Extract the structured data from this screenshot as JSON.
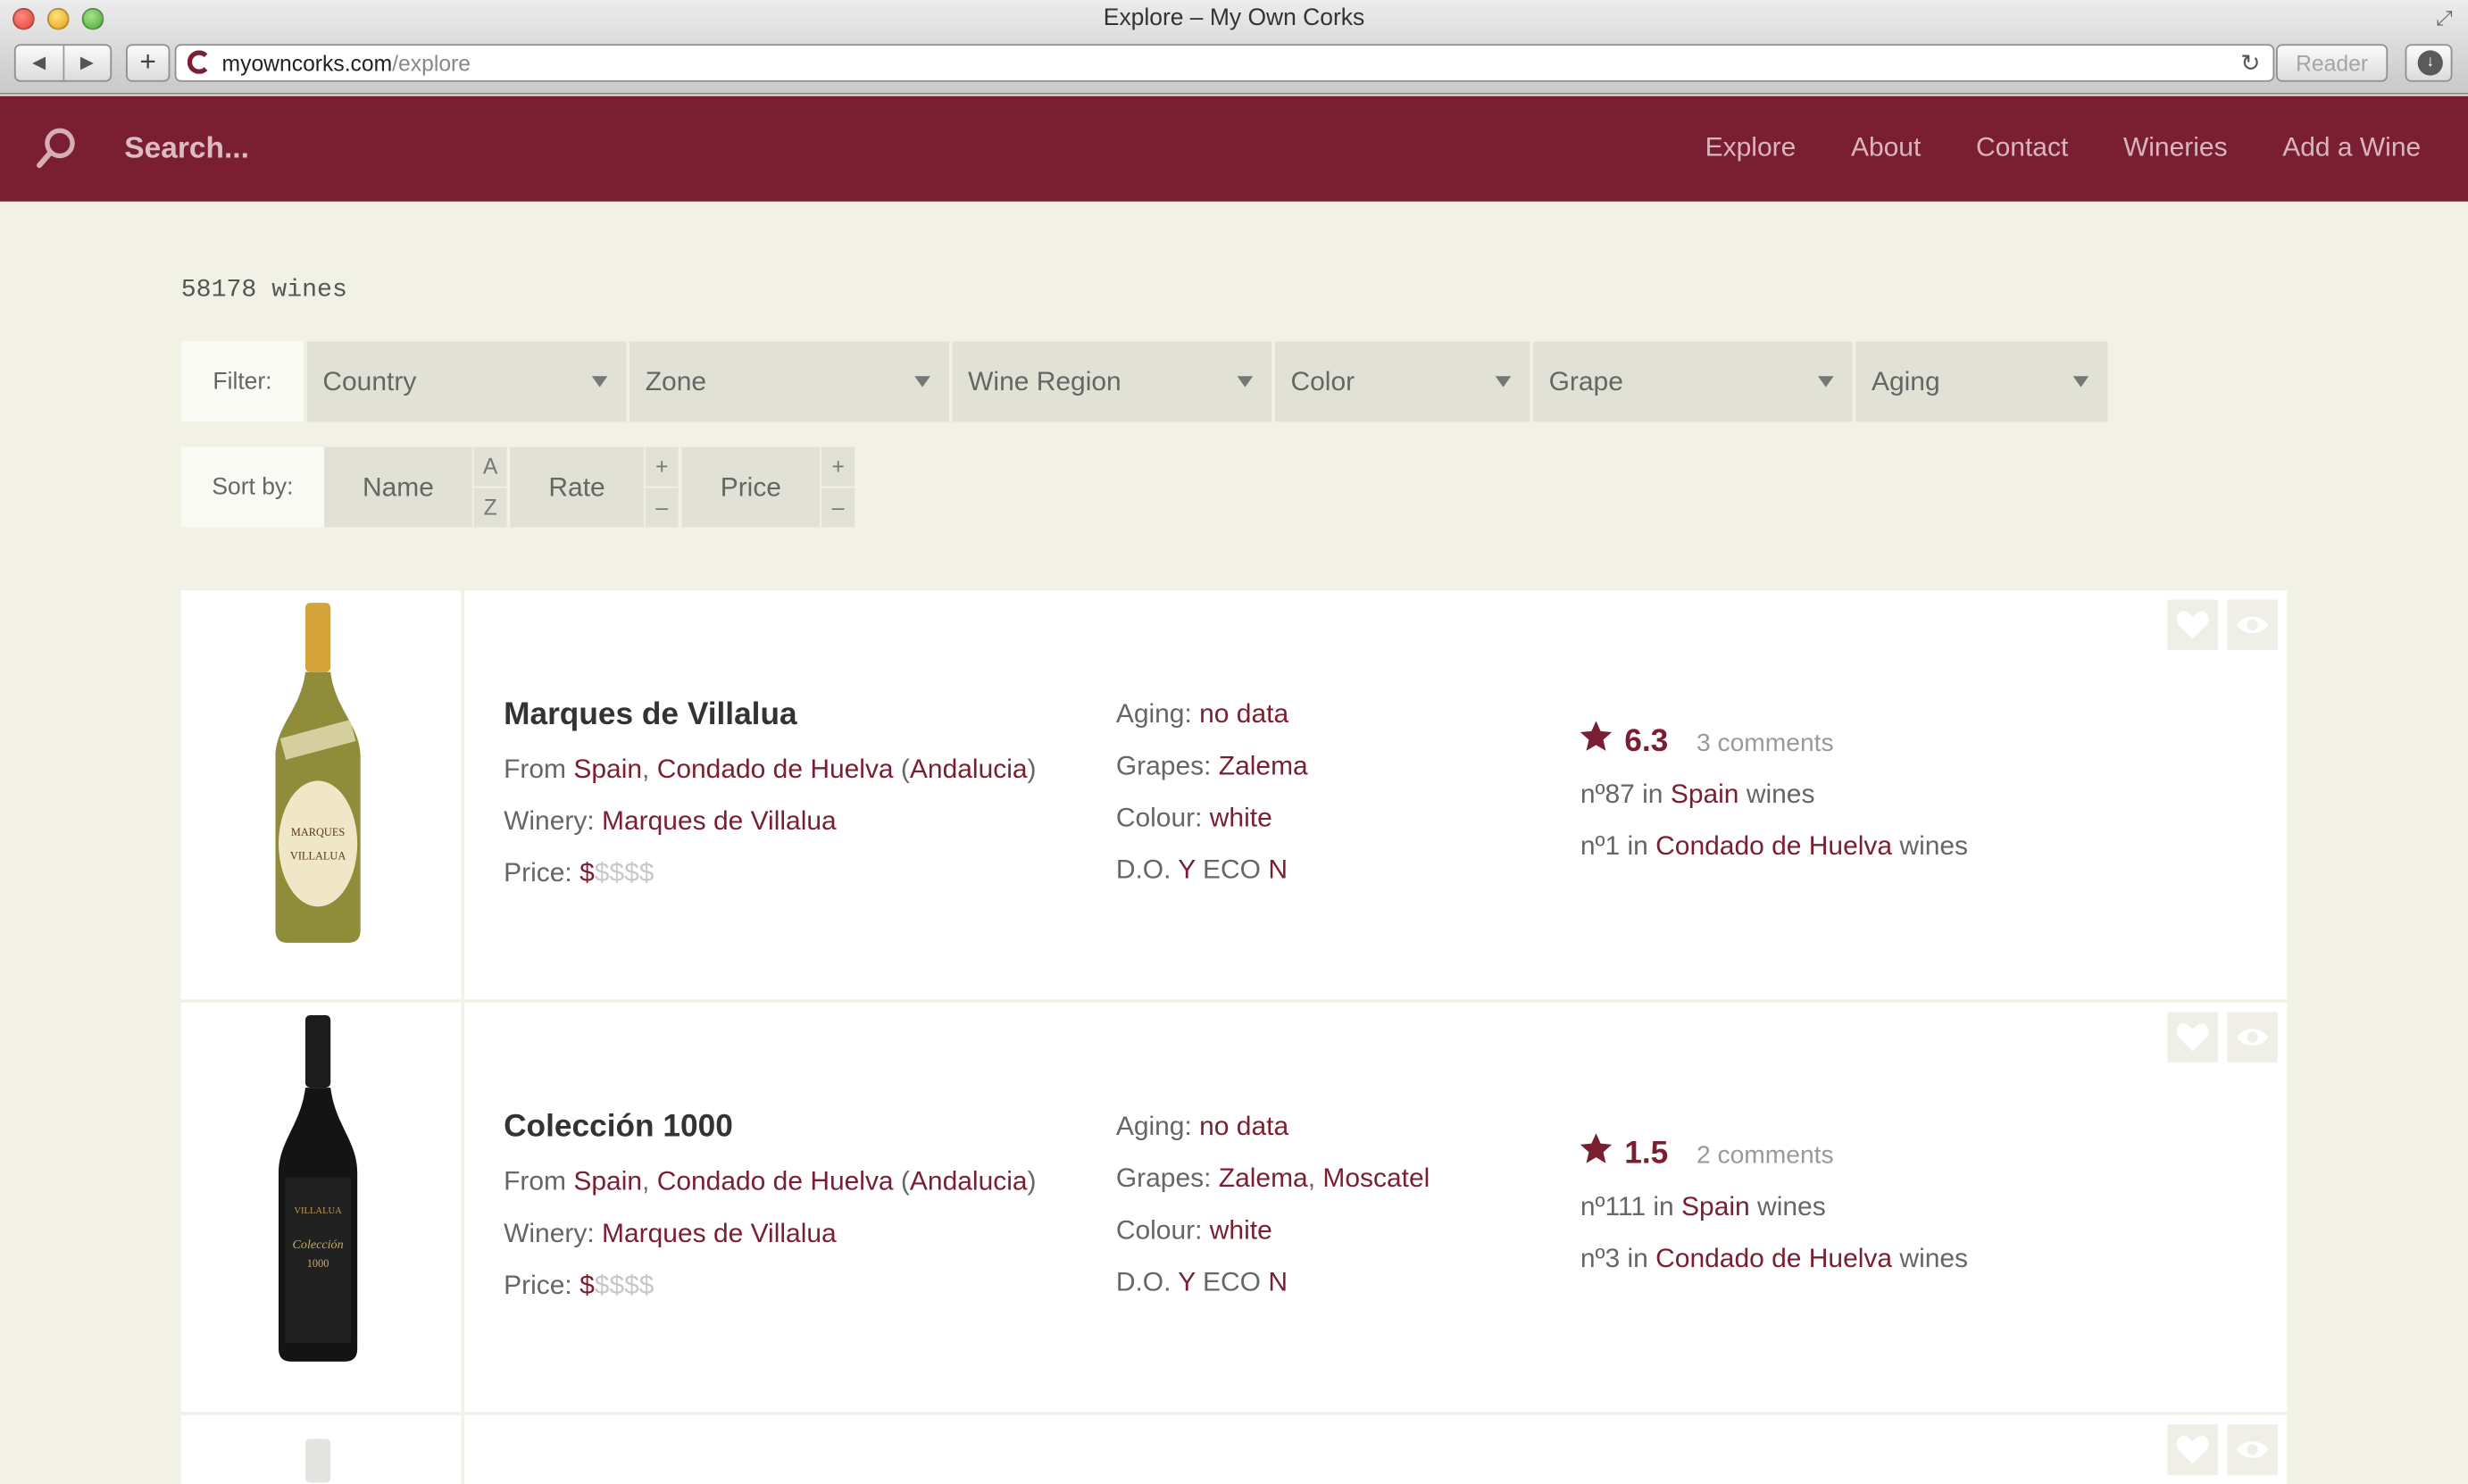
{
  "browser": {
    "window_title": "Explore – My Own Corks",
    "url_domain": "myowncorks.com",
    "url_path": "/explore",
    "reader_label": "Reader"
  },
  "nav": {
    "search_placeholder": "Search...",
    "menu": [
      "Explore",
      "About",
      "Contact",
      "Wineries",
      "Add a Wine"
    ]
  },
  "wine_count": "58178 wines",
  "filter": {
    "label": "Filter:",
    "options": [
      "Country",
      "Zone",
      "Wine Region",
      "Color",
      "Grape",
      "Aging"
    ]
  },
  "sort": {
    "label": "Sort by:",
    "name": "Name",
    "name_up": "A",
    "name_down": "Z",
    "rate": "Rate",
    "rate_up": "+",
    "rate_down": "–",
    "price": "Price",
    "price_up": "+",
    "price_down": "–"
  },
  "labels": {
    "from": "From",
    "winery": "Winery:",
    "price": "Price:",
    "aging": "Aging:",
    "grapes": "Grapes:",
    "colour": "Colour:",
    "do": "D.O.",
    "in": "in",
    "wines": "wines"
  },
  "wines": [
    {
      "name": "Marques de Villalua",
      "country": "Spain",
      "zone": "Condado de Huelva",
      "region": "Andalucia",
      "winery": "Marques de Villalua",
      "price_level": "$",
      "price_rest": "$$$$",
      "aging": "no data",
      "grapes": [
        "Zalema"
      ],
      "colour": "white",
      "do_y": "Y",
      "do_eco": "ECO",
      "do_n": "N",
      "rating": "6.3",
      "comments": "3 comments",
      "rank_country": "nº87",
      "rank_zone": "nº1",
      "bottle_color": "#8f8d3a"
    },
    {
      "name": "Colección 1000",
      "country": "Spain",
      "zone": "Condado de Huelva",
      "region": "Andalucia",
      "winery": "Marques de Villalua",
      "price_level": "$",
      "price_rest": "$$$$",
      "aging": "no data",
      "grapes": [
        "Zalema",
        "Moscatel"
      ],
      "colour": "white",
      "do_y": "Y",
      "do_eco": "ECO",
      "do_n": "N",
      "rating": "1.5",
      "comments": "2 comments",
      "rank_country": "nº111",
      "rank_zone": "nº3",
      "bottle_color": "#141414"
    }
  ],
  "colors": {
    "brand": "#7a1f31",
    "background": "#f1f1e6"
  }
}
